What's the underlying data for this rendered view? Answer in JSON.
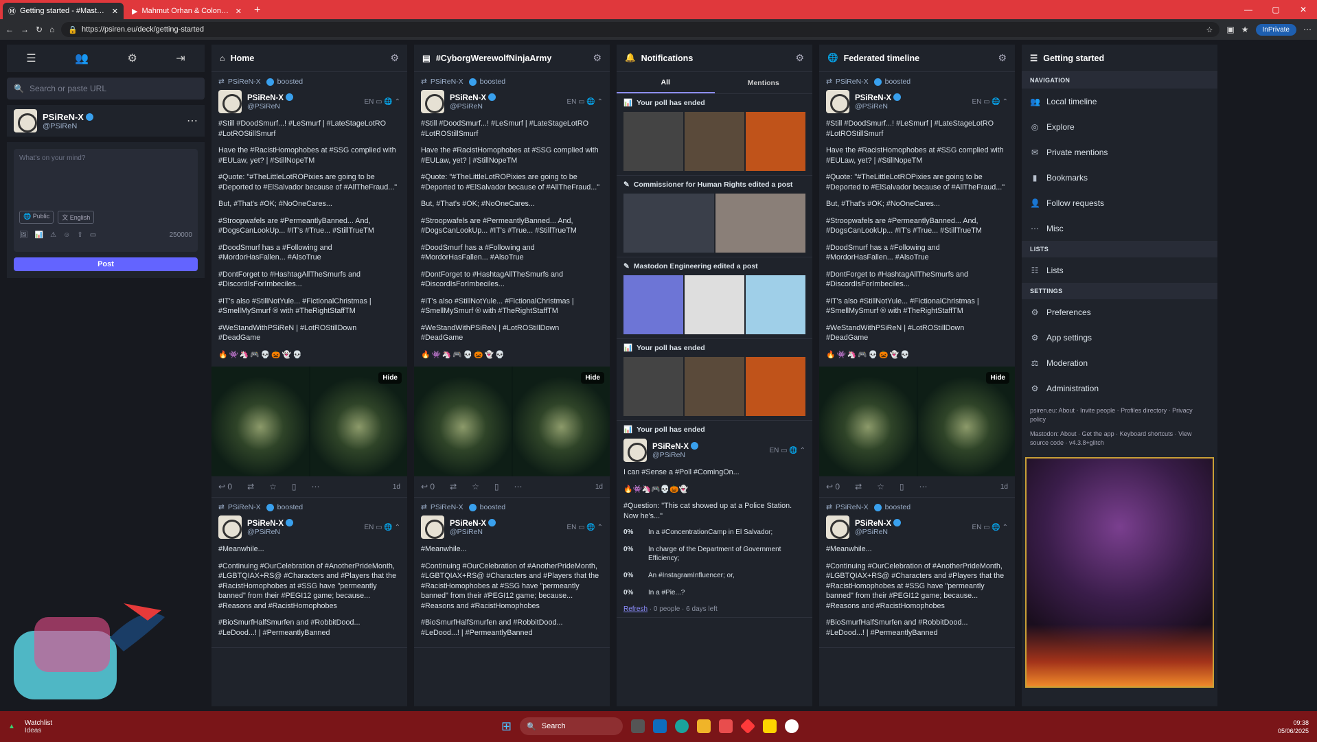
{
  "browser": {
    "tabs": [
      {
        "label": "Getting started - #MastodonSpyl...",
        "active": true
      },
      {
        "label": "Mahmut Orhan & Colonel Bagsh...",
        "active": false
      }
    ],
    "url": "https://psiren.eu/deck/getting-started",
    "profile_label": "InPrivate"
  },
  "drawer": {
    "search_placeholder": "Search or paste URL",
    "account": {
      "name": "PSiReN-X",
      "handle": "@PSiReN"
    },
    "compose": {
      "placeholder": "What's on your mind?",
      "visibility": "Public",
      "language": "English",
      "char_count": "250000",
      "post_label": "Post"
    }
  },
  "status_text": {
    "boosted": "boosted",
    "name": "PSiReN-X",
    "handle": "@PSiReN",
    "meta": "EN",
    "p1": "#Still #DoodSmurf...! #LeSmurf | #LateStageLotRO #LotROStillSmurf",
    "p2": "Have the #RacistHomophobes at #SSG complied with #EULaw, yet? | #StillNopeTM",
    "p3": "#Quote: \"#TheLittleLotROPixies are going to be #Deported to #ElSalvador because of #AllTheFraud...\"",
    "p4": "But, #That's #OK; #NoOneCares...",
    "p5": "#Stroopwafels are #PermeantlyBanned... And, #DogsCanLookUp... #IT's #True... #StillTrueTM",
    "p6": "#DoodSmurf has a #Following and #MordorHasFallen... #AlsoTrue",
    "p7": "#DontForget to #HashtagAllTheSmurfs and #DiscordIsForImbeciles...",
    "p8": "#IT's also #StillNotYule... #FictionalChristmas | #SmellMySmurf ® with #TheRightStaffTM",
    "p9": "#WeStandWithPSiReN | #LotROStillDown #DeadGame",
    "hide": "Hide",
    "reply_count": "0",
    "age": "1d",
    "q1": "#Meanwhile...",
    "q2": "#Continuing #OurCelebration of #AnotherPrideMonth, #LGBTQIAX+RS@ #Characters and #Players that the #RacistHomophobes at #SSG have \"permeantly banned\" from their #PEGI12 game; because... #Reasons and #RacistHomophobes",
    "q3": "#BioSmurfHalfSmurfen and #RobbitDood... #LeDood...! | #PermeantlyBanned"
  },
  "columns": {
    "home": {
      "title": "Home"
    },
    "cyborg": {
      "title": "#CyborgWerewolfNinjaArmy"
    },
    "notifications": {
      "title": "Notifications",
      "tab_all": "All",
      "tab_mentions": "Mentions",
      "n1": "Your poll has ended",
      "n2": "Commissioner for Human Rights edited a post",
      "n3": "Mastodon Engineering edited a post",
      "n4": "Your poll has ended",
      "n5": "Your poll has ended",
      "poll_text": "I can #Sense a #Poll #ComingOn...",
      "question": "#Question: \"This cat showed up at a Police Station. Now he's...\"",
      "options": [
        {
          "pct": "0%",
          "label": "In a #ConcentrationCamp in El Salvador;"
        },
        {
          "pct": "0%",
          "label": "In charge of the Department of Government Efficiency;"
        },
        {
          "pct": "0%",
          "label": "An #InstagramInfluencer; or,"
        },
        {
          "pct": "0%",
          "label": "In a #Pie...?"
        }
      ],
      "refresh": "Refresh",
      "poll_meta": "· 0 people · 6 days left"
    },
    "federated": {
      "title": "Federated timeline"
    }
  },
  "getting_started": {
    "title": "Getting started",
    "nav_header": "NAVIGATION",
    "nav": [
      "Local timeline",
      "Explore",
      "Private mentions",
      "Bookmarks",
      "Follow requests",
      "Misc"
    ],
    "lists_header": "LISTS",
    "lists": [
      "Lists"
    ],
    "settings_header": "SETTINGS",
    "settings": [
      "Preferences",
      "App settings",
      "Moderation",
      "Administration"
    ],
    "footer1": "psiren.eu: About · Invite people · Profiles directory · Privacy policy",
    "footer2": "Mastodon: About · Get the app · Keyboard shortcuts · View source code · v4.3.8+glitch"
  },
  "taskbar": {
    "widget_title": "Watchlist",
    "widget_sub": "Ideas",
    "search": "Search",
    "time": "09:38",
    "date": "05/06/2025"
  }
}
